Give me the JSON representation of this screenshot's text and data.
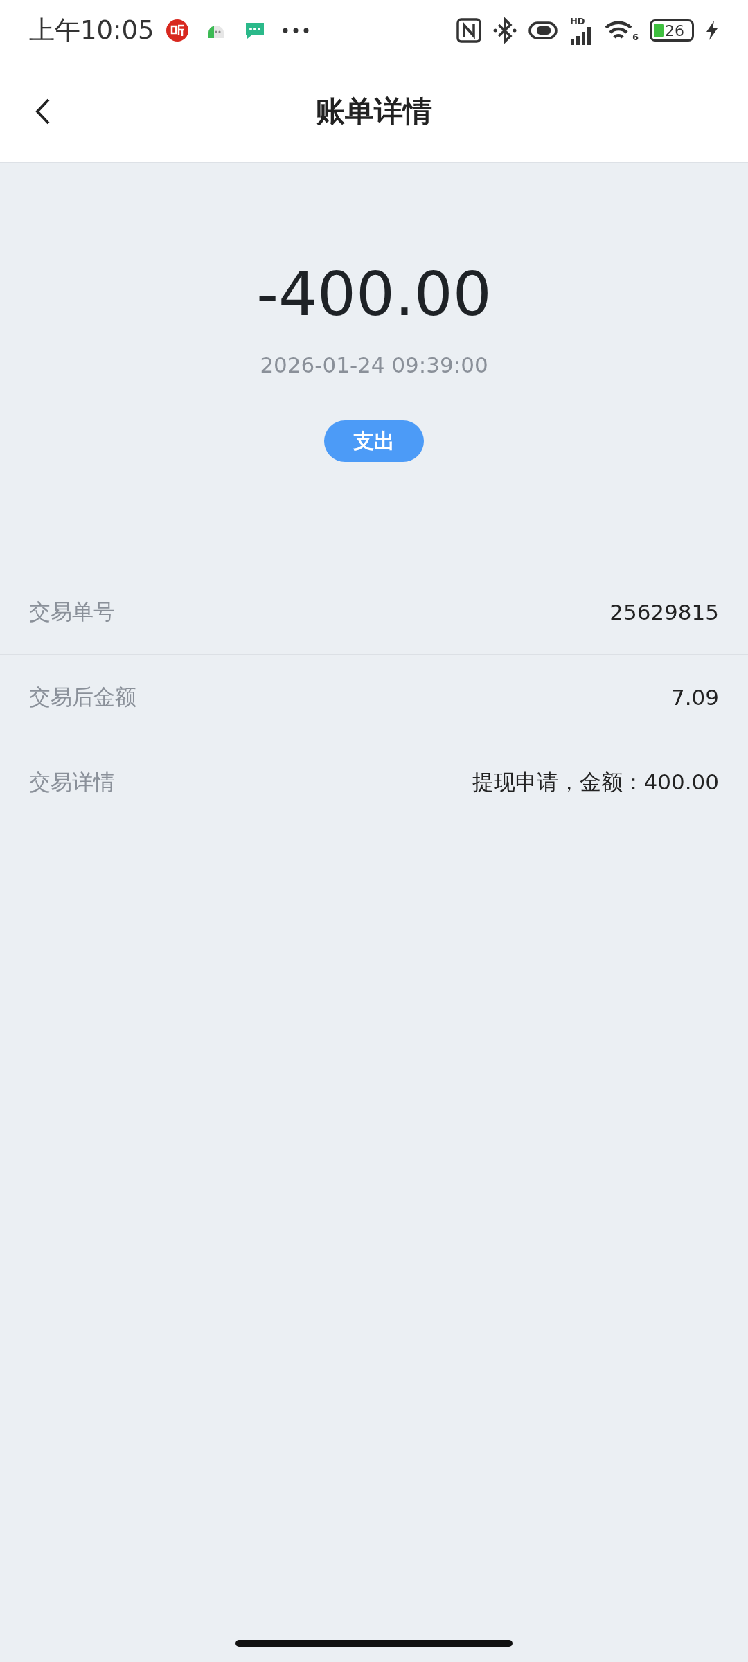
{
  "status_bar": {
    "time": "上午10:05",
    "signal_label": "HD",
    "wifi_label": "6",
    "battery": "26",
    "charging": true
  },
  "header": {
    "title": "账单详情"
  },
  "summary": {
    "amount": "-400.00",
    "datetime": "2026-01-24 09:39:00",
    "tag": "支出"
  },
  "details": [
    {
      "label": "交易单号",
      "value": "25629815"
    },
    {
      "label": "交易后金额",
      "value": "7.09"
    },
    {
      "label": "交易详情",
      "value": "提现申请，金额：400.00"
    }
  ]
}
